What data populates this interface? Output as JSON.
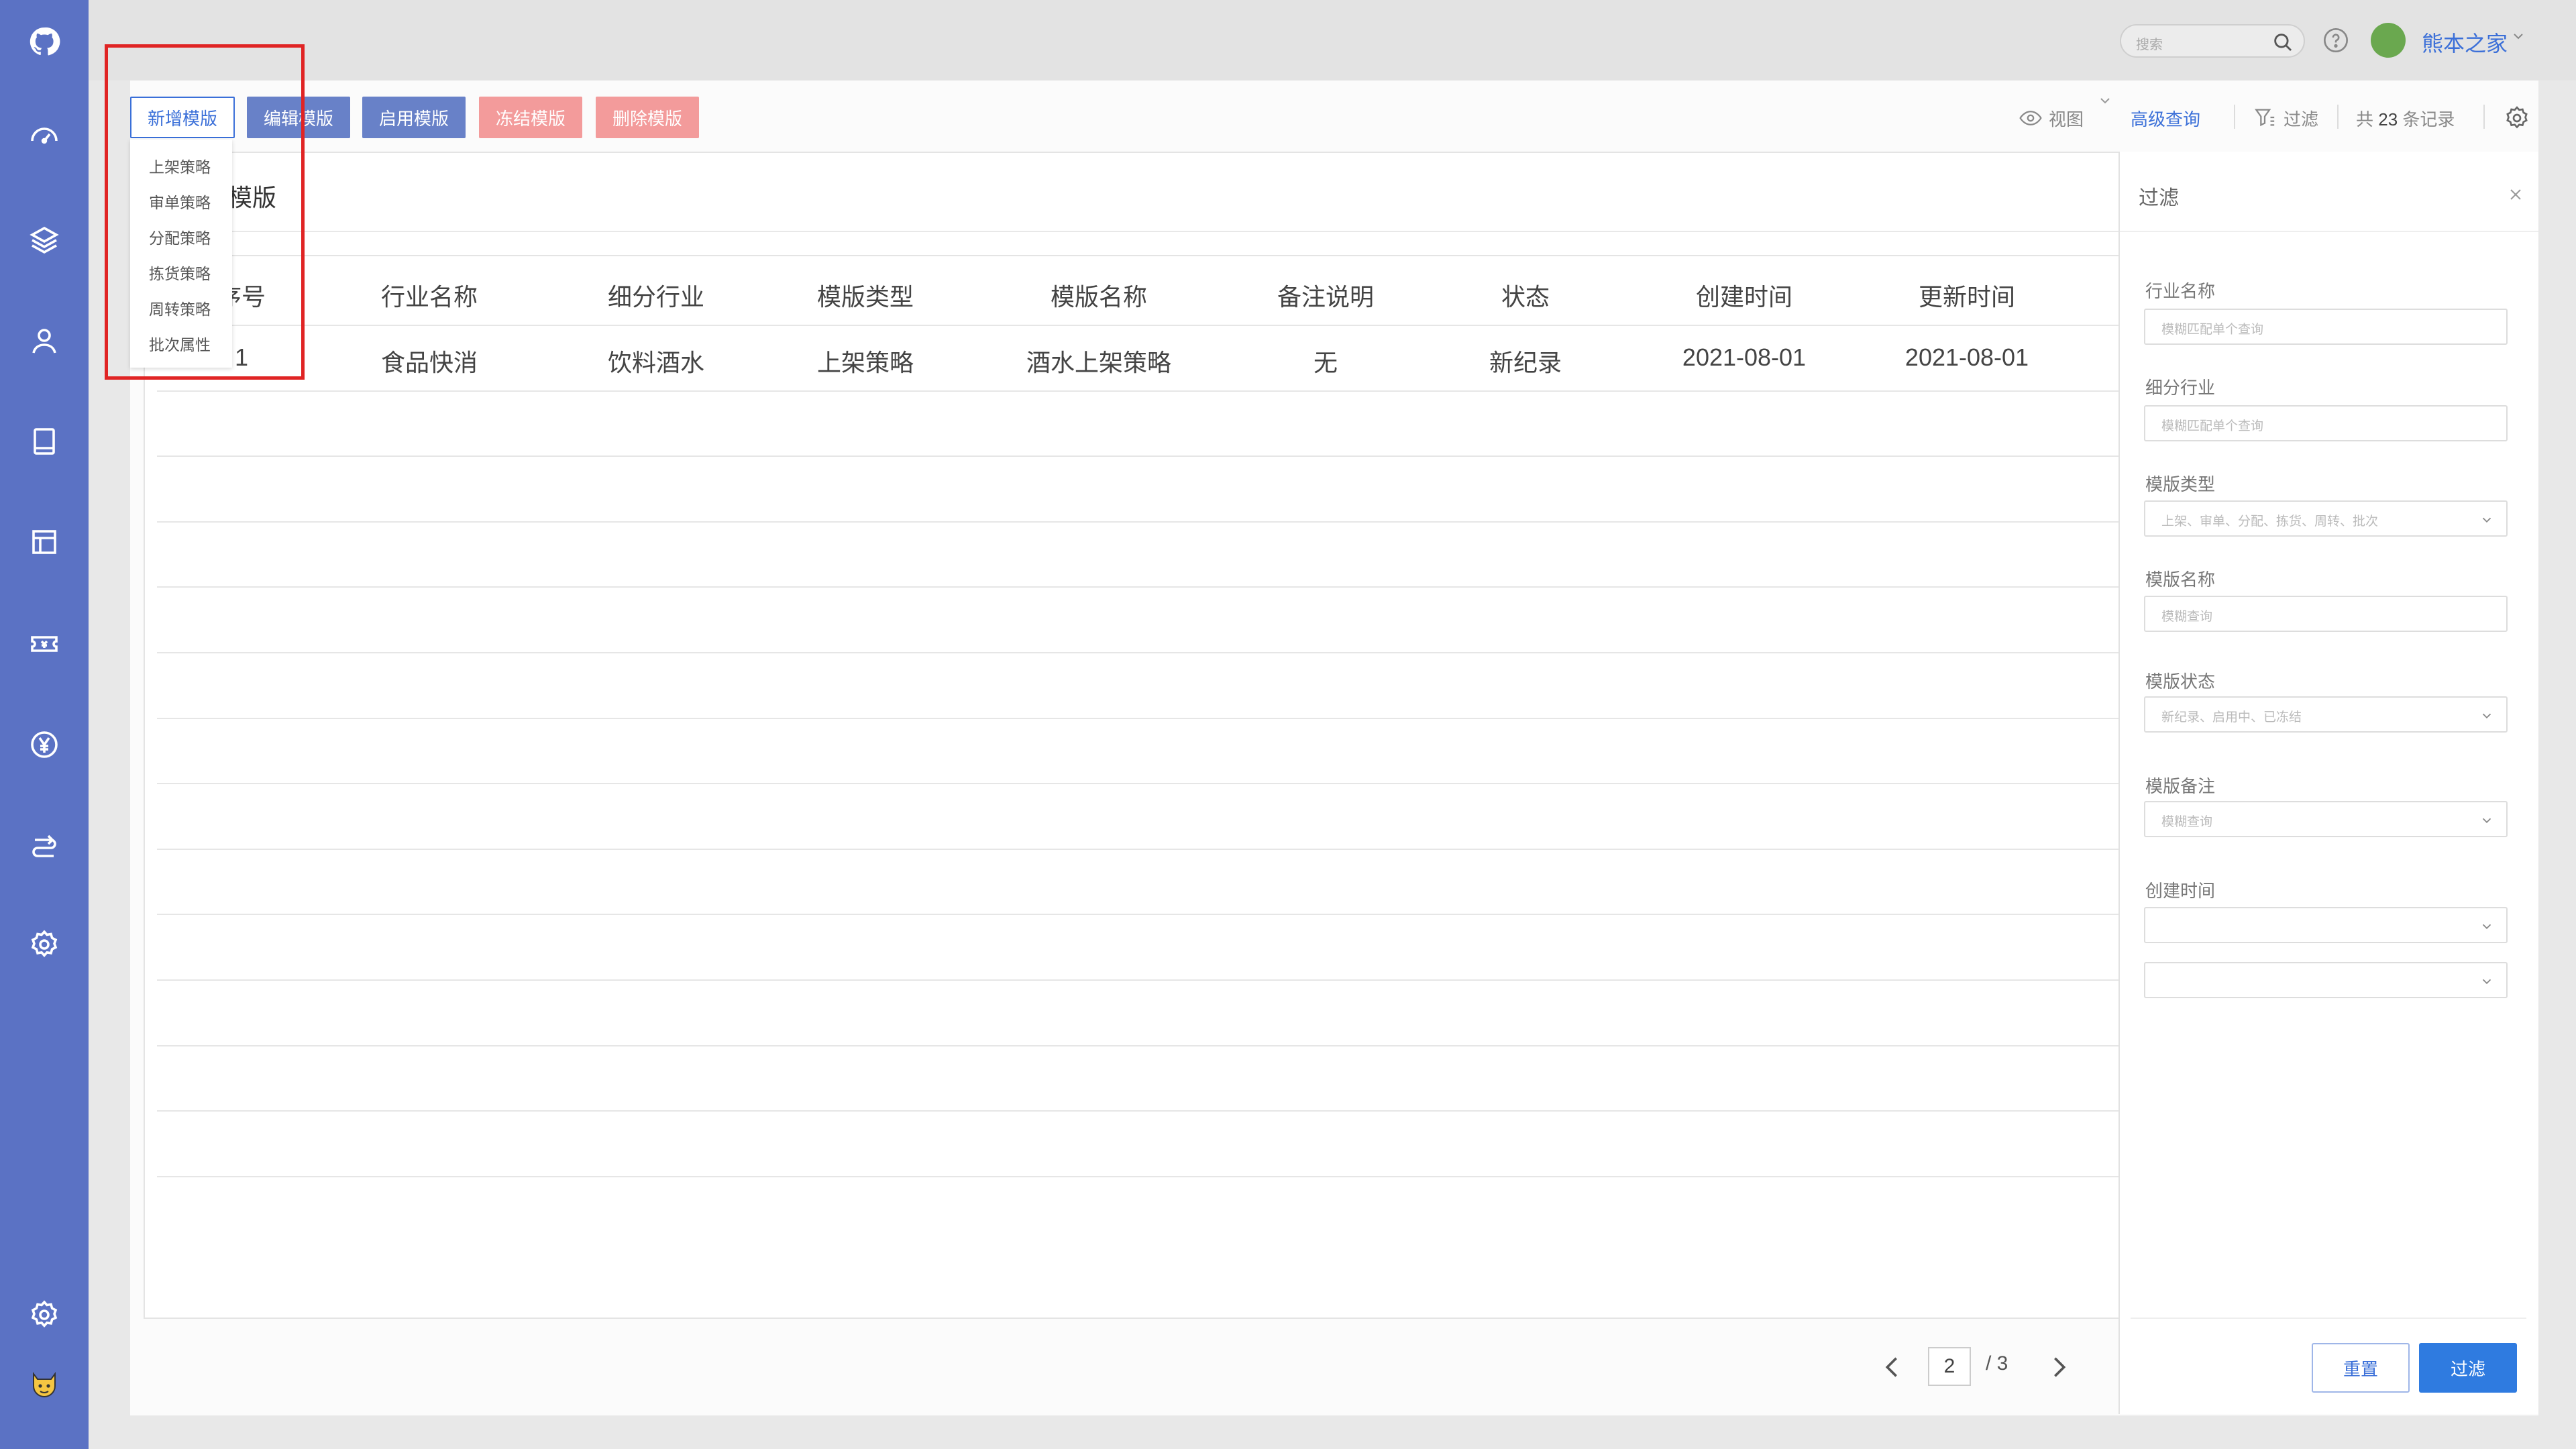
{
  "header": {
    "search_placeholder": "搜索",
    "user_name": "熊本之家"
  },
  "toolbar": {
    "new_label": "新增模版",
    "edit_label": "编辑模版",
    "enable_label": "启用模版",
    "freeze_label": "冻结模版",
    "delete_label": "删除模版"
  },
  "dropdown": {
    "items": [
      "上架策略",
      "审单策略",
      "分配策略",
      "拣货策略",
      "周转策略",
      "批次属性"
    ]
  },
  "right_toolbar": {
    "view_label": "视图",
    "advanced_label": "高级查询",
    "filter_label": "过滤",
    "records_prefix": "共",
    "records_count": "23",
    "records_suffix": "条记录"
  },
  "card": {
    "title": "模版"
  },
  "table": {
    "headers": [
      "序号",
      "行业名称",
      "细分行业",
      "模版类型",
      "模版名称",
      "备注说明",
      "状态",
      "创建时间",
      "更新时间"
    ],
    "rows": [
      [
        "1",
        "食品快消",
        "饮料酒水",
        "上架策略",
        "酒水上架策略",
        "无",
        "新纪录",
        "2021-08-01",
        "2021-08-01"
      ]
    ]
  },
  "pagination": {
    "current": "2",
    "total": "/ 3"
  },
  "filter_panel": {
    "title": "过滤",
    "fields": [
      {
        "label": "行业名称",
        "placeholder": "模糊匹配单个查询"
      },
      {
        "label": "细分行业",
        "placeholder": "模糊匹配单个查询"
      },
      {
        "label": "模版类型",
        "placeholder": "上架、审单、分配、拣货、周转、批次"
      },
      {
        "label": "模版名称",
        "placeholder": "模糊查询"
      },
      {
        "label": "模版状态",
        "placeholder": "新纪录、启用中、已冻结"
      },
      {
        "label": "模版备注",
        "placeholder": "模糊查询"
      },
      {
        "label": "创建时间",
        "placeholder": ""
      }
    ],
    "reset_label": "重置",
    "submit_label": "过滤"
  },
  "colors": {
    "sidebar": "#5b72c4",
    "primary": "#3a6fd8",
    "danger_button": "#f39b9b",
    "highlight": "#e02424"
  }
}
